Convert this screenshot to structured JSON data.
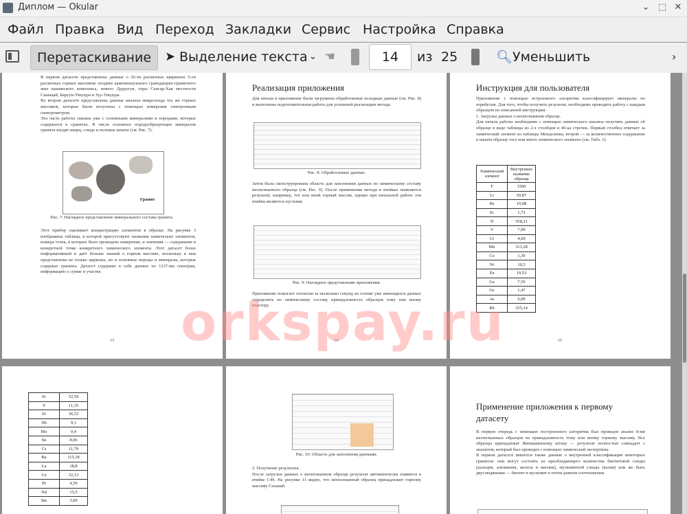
{
  "window": {
    "title": "Диплом  — Okular"
  },
  "menu": [
    "Файл",
    "Правка",
    "Вид",
    "Переход",
    "Закладки",
    "Сервис",
    "Настройка",
    "Справка"
  ],
  "toolbar": {
    "drag": "Перетаскивание",
    "select_text": "Выделение текста",
    "page_current": "14",
    "page_of": "из",
    "page_total": "25",
    "zoom_out": "Уменьшить"
  },
  "watermark": "orkspay.ru",
  "page13": {
    "p1": "В первом датасете представлены данные о 26-ти различных щирконах 5-ти различных горных массивов: позднее камениноульного гранодиорит-гранитного жил кашинского комплекса, нового Дурдзгуя, горы Сангар-Хая местности Сашацай, Баруун-Уицзура и Зуу-Уицзура.",
    "p2": "Во втором датасете представлены данные анализа микрозонда тех же горных массивов, которые были получены с помощью измерения электронным спектрометром.",
    "p3": "Эта часть работы связана уже с основными минералами и породами, которые содержатся в гранитах. В числе основных породообразующих минералов гранита входят кварц, слюда и полевые шпаты (см. Рис. 7).",
    "granite_label": "Гранит",
    "caption": "Рис. 7: Наглядное представление минерального состава гранита.",
    "p4": "Этот прибор оценивает концентрацию элементов в образце. На рисунке 3 изображена таблица, в которой присутствуют названия химических элементов, номера точек, в которых было проведено измерение, и значения — содержание в конкретной точке конкретного химического элемента. Этот датасет более информативный и даёт больше знаний о горном массиве, поскольку в нем представлены не только цирконы, но и основные породы и минералы, которые содержат граниты. Датасет содержит в себе данные по 1237-ми спектрам, информацию о сумме и участке.",
    "num": "13"
  },
  "page14": {
    "heading": "Реализация приложения",
    "p1": "Для начала в приложение были загружены обработанные исходные данные (см. Рис. 8) и выполнена подготовительная работа для успешной реализации метода.",
    "caption1": "Рис. 8: Обработанные данные.",
    "p2": "Затем была сконструирована область для заполнения данных по химическому составу неопознанного образца (см. Рис. 9). После применения метода в ячейках появляется результат, например, тот или иной горный массив, однако при начальной работе эти ячейки являются пустыми.",
    "caption2": "Рис. 9: Наглядное представление приложения.",
    "p3": "Приложение помогает геологам за несколько секунд на основе уже имеющихся данных определить по химическому составу принадлежность образцов тому или иному кластеру.",
    "num": "14"
  },
  "page15": {
    "heading": "Инструкция для пользователя",
    "p1": "Приложение с помощью встроенного алгоритма классифицирует минералы по атрибутам. Для того, чтобы получить результат, необходимо проводить работу с каждым образцом по описанной инструкции:",
    "li1": "1.  Загрузка данных о неопознанном образце.",
    "p2": "Для начала работы необходимо с помощью химического анализа получить данные об образце в виде таблицы из 2-х столбцов и 40-ка строчек. Первый столбец отвечает за химический элемент из таблицы Менделеева, второй — за количественное содержание в нашем образце того или иного химического элемента (см. Табл. 1).",
    "table_header": [
      "Химический элемент",
      "Внутреннее название образца"
    ],
    "rows": [
      [
        "F",
        "1500"
      ],
      [
        "Li",
        "50,87"
      ],
      [
        "Be",
        "10,08"
      ],
      [
        "Sc",
        "1,72"
      ],
      [
        "Ti",
        "558,21"
      ],
      [
        "V",
        "7,99"
      ],
      [
        "Cr",
        "4,69"
      ],
      [
        "Mn",
        "313,28"
      ],
      [
        "Co",
        "1,39"
      ],
      [
        "Ni",
        "10,5"
      ],
      [
        "Zn",
        "19,53"
      ],
      [
        "Ga",
        "7,59"
      ],
      [
        "Ge",
        "1,47"
      ],
      [
        "As",
        "6,09"
      ],
      [
        "Rb",
        "335,14"
      ]
    ],
    "num": "15"
  },
  "page16": {
    "rows": [
      [
        "Sr",
        "52,59"
      ],
      [
        "Y",
        "11,35"
      ],
      [
        "Zr",
        "36,52"
      ],
      [
        "Nb",
        "9,1"
      ],
      [
        "Mo",
        "0,4"
      ],
      [
        "Sn",
        "8,06"
      ],
      [
        "Cs",
        "11,79"
      ],
      [
        "Ba",
        "115,18"
      ],
      [
        "La",
        "18,8"
      ],
      [
        "Ce",
        "32,13"
      ],
      [
        "Pr",
        "4,59"
      ],
      [
        "Nd",
        "15,5"
      ],
      [
        "Sm",
        "3,09"
      ]
    ]
  },
  "page17": {
    "caption": "Рис. 10: Область для заполнения данными.",
    "li2": "2.  Получение результата.",
    "p1": "После загрузки данных о неопознанном образце результат автоматически появится в ячейке C49. На рисунке 11 видно, что неопознанный образец принадлежит горному массиву Сахаиай."
  },
  "page18": {
    "heading": "Применение приложения к первому датасету",
    "p1": "В первую очередь с помощью построенного алгоритма был проведен анализ 8-ми неопознанных образцов на принадлежность тому или иному горному массиву. Все образцы принадлежат Жипашинскому штоку — результат полностью совпадает с анализом, который был проведен с помощью химической экспертизы.",
    "p2": "В первом датасете имеются также данные о внутренней классификации некоторых гранитов: они могут состоять из преобладающего количества биотитовой слюды (кальция, алюминия, железа и магния), мусковитной слюды (калия) или же быть двуслюдяными — биотит и мусковит в почти равном соотношении."
  }
}
